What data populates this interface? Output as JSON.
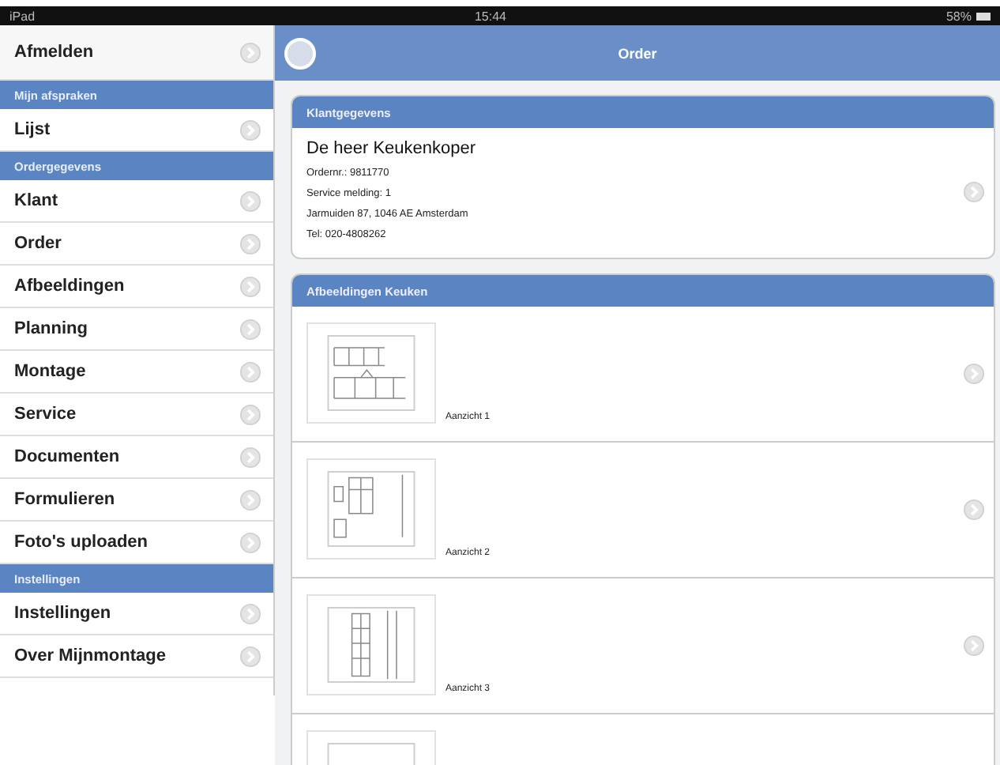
{
  "status_bar": {
    "device": "iPad",
    "time": "15:44",
    "battery": "58%"
  },
  "sidebar": {
    "items": [
      {
        "kind": "action",
        "label": "Afmelden"
      },
      {
        "kind": "section",
        "label": "Mijn afspraken"
      },
      {
        "kind": "row",
        "label": "Lijst"
      },
      {
        "kind": "section",
        "label": "Ordergegevens"
      },
      {
        "kind": "row",
        "label": "Klant"
      },
      {
        "kind": "row",
        "label": "Order"
      },
      {
        "kind": "row",
        "label": "Afbeeldingen"
      },
      {
        "kind": "row",
        "label": "Planning"
      },
      {
        "kind": "row",
        "label": "Montage"
      },
      {
        "kind": "row",
        "label": "Service"
      },
      {
        "kind": "row",
        "label": "Documenten"
      },
      {
        "kind": "row",
        "label": "Formulieren"
      },
      {
        "kind": "row",
        "label": "Foto's uploaden"
      },
      {
        "kind": "section",
        "label": "Instellingen"
      },
      {
        "kind": "row",
        "label": "Instellingen"
      },
      {
        "kind": "row",
        "label": "Over Mijnmontage"
      }
    ]
  },
  "navbar": {
    "title": "Order"
  },
  "customer_card": {
    "title": "Klantgegevens",
    "name": "De heer Keukenkoper",
    "lines": [
      "Ordernr.: 9811770",
      "Service melding: 1",
      "Jarmuiden 87, 1046 AE Amsterdam",
      "Tel: 020-4808262"
    ]
  },
  "images_card": {
    "title": "Afbeeldingen Keuken",
    "items": [
      {
        "kind": "picture",
        "caption": "Aanzicht 1",
        "chevron": true
      },
      {
        "kind": "picture",
        "caption": "Aanzicht 2",
        "chevron": true
      },
      {
        "kind": "picture",
        "caption": "Aanzicht 3",
        "chevron": true
      },
      {
        "kind": "picture",
        "chevron": false
      }
    ]
  }
}
